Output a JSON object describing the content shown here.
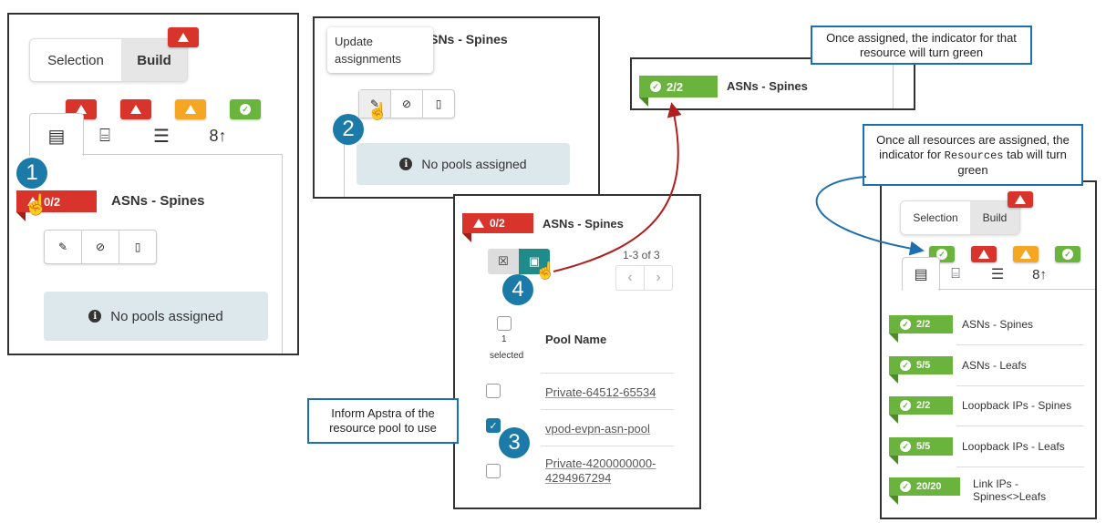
{
  "panel1": {
    "tabs": {
      "selection": "Selection",
      "build": "Build"
    },
    "badge_colors": [
      "#d9342b",
      "#d9342b",
      "#f5a623",
      "#6ab43e"
    ],
    "step": "1",
    "tag": {
      "count": "0/2",
      "name": "ASNs - Spines"
    },
    "no_pools": "No pools assigned"
  },
  "panel2": {
    "tooltip": "Update assignments",
    "title": "ASNs - Spines",
    "step": "2",
    "no_pools": "No pools assigned"
  },
  "panel3": {
    "tag": {
      "count": "0/2",
      "name": "ASNs - Spines"
    },
    "pagination": "1-3 of 3",
    "selected_count": "1",
    "selected_label": "selected",
    "column_header": "Pool Name",
    "pools": [
      "Private-64512-65534",
      "vpod-evpn-asn-pool",
      "Private-4200000000-4294967294"
    ],
    "step3": "3",
    "step4": "4"
  },
  "panel4": {
    "tag": {
      "count": "2/2",
      "name": "ASNs - Spines"
    }
  },
  "callouts": {
    "green_indicator": "Once assigned, the indicator for that resource will turn green",
    "all_assigned_line1": "Once all resources are assigned, the indicator for",
    "all_assigned_mono": "Resources",
    "all_assigned_line2": "tab will turn green",
    "inform": "Inform Apstra of the resource pool to use"
  },
  "panel5": {
    "tabs": {
      "selection": "Selection",
      "build": "Build"
    },
    "resources": [
      {
        "count": "2/2",
        "name": "ASNs - Spines"
      },
      {
        "count": "5/5",
        "name": "ASNs - Leafs"
      },
      {
        "count": "2/2",
        "name": "Loopback IPs - Spines"
      },
      {
        "count": "5/5",
        "name": "Loopback IPs - Leafs"
      },
      {
        "count": "20/20",
        "name": "Link IPs - Spines<>Leafs"
      }
    ]
  },
  "colors": {
    "red": "#d9342b",
    "orange": "#f5a623",
    "green": "#6ab43e",
    "teal": "#1c7aa8",
    "callout_border": "#1c6fb0",
    "arrow_red": "#b01e1e",
    "arrow_blue": "#1c6fb0"
  }
}
